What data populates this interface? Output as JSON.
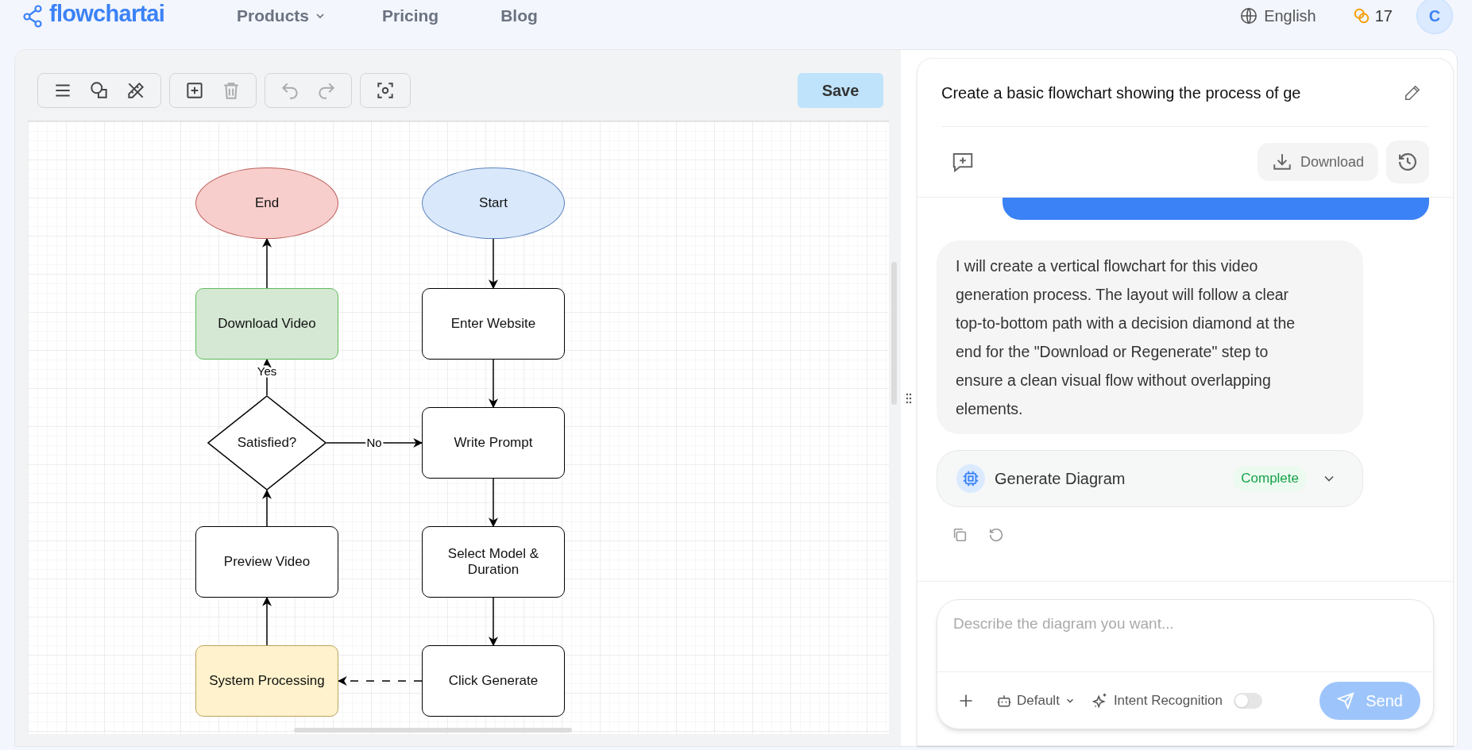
{
  "header": {
    "logo": "flowchartai",
    "nav": [
      {
        "label": "Products",
        "dropdown": true
      },
      {
        "label": "Pricing",
        "dropdown": false
      },
      {
        "label": "Blog",
        "dropdown": false
      }
    ],
    "language": "English",
    "credits": "17",
    "avatar": "C"
  },
  "editor": {
    "toolbar": [
      {
        "buttons": [
          {
            "kind": "menu",
            "disabled": false
          },
          {
            "kind": "shapes",
            "disabled": false
          },
          {
            "kind": "tools",
            "disabled": false
          }
        ]
      },
      {
        "buttons": [
          {
            "kind": "add",
            "disabled": false
          },
          {
            "kind": "delete",
            "disabled": true
          }
        ]
      },
      {
        "buttons": [
          {
            "kind": "undo",
            "disabled": true
          },
          {
            "kind": "redo",
            "disabled": true
          }
        ]
      },
      {
        "buttons": [
          {
            "kind": "fit",
            "disabled": false
          }
        ]
      }
    ],
    "save": "Save",
    "diagram": {
      "nodes": [
        {
          "kind": "ellipse",
          "label": "End",
          "color": "#f8cecc"
        },
        {
          "kind": "ellipse",
          "label": "Start",
          "color": "#dae8fc"
        },
        {
          "kind": "rect",
          "label": "Download Video",
          "color": "#d5e8d4"
        },
        {
          "kind": "rect",
          "label": "Enter Website",
          "color": "#ffffff"
        },
        {
          "kind": "diamond",
          "label": "Satisfied?",
          "color": "#ffffff"
        },
        {
          "kind": "rect",
          "label": "Write Prompt",
          "color": "#ffffff"
        },
        {
          "kind": "rect",
          "label": "Preview Video",
          "color": "#ffffff"
        },
        {
          "kind": "rect",
          "label": "Select Model & Duration",
          "color": "#ffffff"
        },
        {
          "kind": "rect",
          "label": "System Processing",
          "color": "#fff2cc"
        },
        {
          "kind": "rect",
          "label": "Click Generate",
          "color": "#ffffff"
        }
      ],
      "edges": [
        {
          "kind": "solid"
        },
        {
          "kind": "solid"
        },
        {
          "kind": "solid"
        },
        {
          "kind": "solid"
        },
        {
          "kind": "dashed"
        },
        {
          "kind": "solid"
        },
        {
          "kind": "solid"
        },
        {
          "kind": "solid",
          "label": "Yes"
        },
        {
          "kind": "solid",
          "label": "No"
        },
        {
          "kind": "solid"
        }
      ]
    }
  },
  "chat": {
    "title": "Create a basic flowchart showing the process of ge",
    "download": "Download",
    "reply": "I will create a vertical flowchart for this video generation process. The layout will follow a clear top-to-bottom path with a decision diamond at the end for the \"Download or Regenerate\" step to ensure a clean visual flow without overlapping elements.",
    "tool": {
      "label": "Generate Diagram",
      "status": "Complete",
      "expanded": false
    },
    "composer": {
      "placeholder": "Describe the diagram you want...",
      "model": "Default",
      "intent": {
        "label": "Intent Recognition",
        "on": false
      },
      "send": {
        "label": "Send",
        "disabled": true
      }
    }
  }
}
